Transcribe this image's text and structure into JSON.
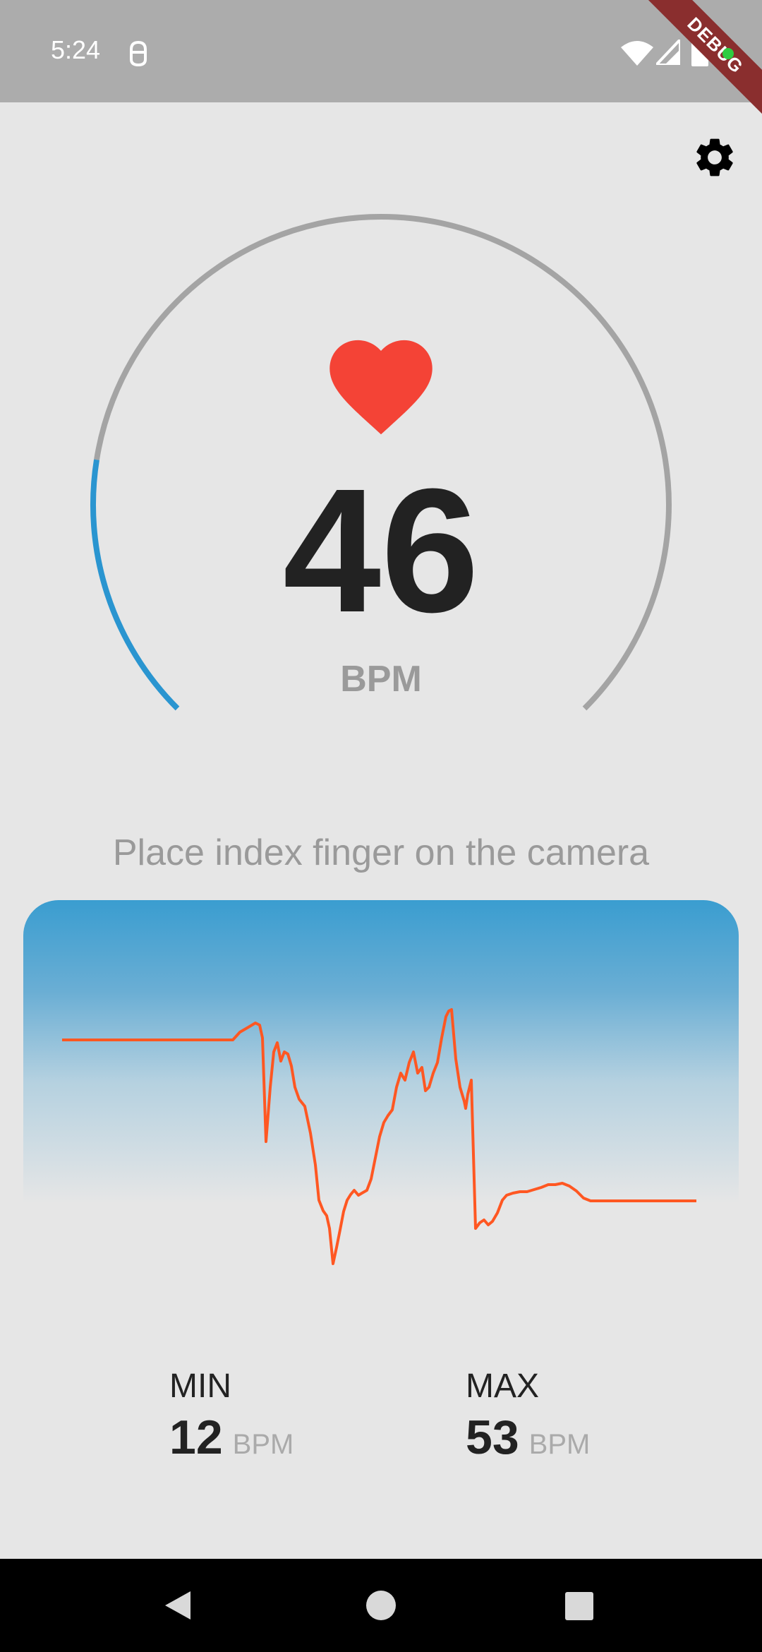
{
  "status_bar": {
    "time": "5:24",
    "debug_label": "DEBUG",
    "icons": [
      "notification-icon",
      "wifi-icon",
      "signal-icon",
      "battery-icon"
    ]
  },
  "header": {
    "settings_icon": "gear-icon"
  },
  "gauge": {
    "value": 46,
    "unit": "BPM",
    "progress": 0.2,
    "colors": {
      "track": "#a4a4a4",
      "progress": "#2a95d0",
      "heart": "#f44336",
      "value": "#222222"
    }
  },
  "instruction": "Place index finger on the camera",
  "waveform": {
    "line_color": "#ff5722"
  },
  "stats": {
    "min": {
      "label": "MIN",
      "value": "12",
      "unit": "BPM"
    },
    "max": {
      "label": "MAX",
      "value": "53",
      "unit": "BPM"
    }
  },
  "nav_bar": {
    "icons": [
      "back-icon",
      "home-icon",
      "recents-icon"
    ]
  }
}
